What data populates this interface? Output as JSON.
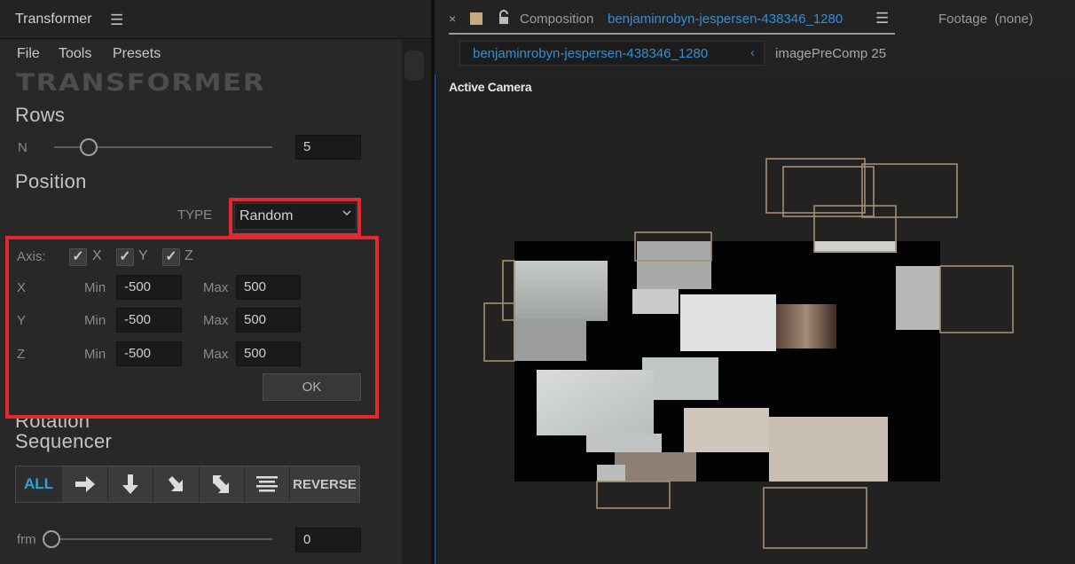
{
  "left_panel": {
    "title": "Transformer",
    "menu": [
      "File",
      "Tools",
      "Presets"
    ],
    "logo": "TRANSFORMER",
    "rows": {
      "title": "Rows",
      "n_label": "N",
      "n_value": "5",
      "slider_level": 0.16
    },
    "position": {
      "title": "Position",
      "type_label": "TYPE",
      "type_value": "Random",
      "axis_label": "Axis:",
      "axes": [
        "X",
        "Y",
        "Z"
      ],
      "axis_checks": [
        "✓",
        "✓",
        "✓"
      ],
      "ranges": [
        {
          "axis": "X",
          "min_label": "Min",
          "min": "-500",
          "max_label": "Max",
          "max": "500"
        },
        {
          "axis": "Y",
          "min_label": "Min",
          "min": "-500",
          "max_label": "Max",
          "max": "500"
        },
        {
          "axis": "Z",
          "min_label": "Min",
          "min": "-500",
          "max_label": "Max",
          "max": "500"
        }
      ],
      "ok_label": "OK"
    },
    "rotation_title": "Rotation",
    "sequencer": {
      "title": "Sequencer",
      "all_label": "ALL",
      "reverse_label": "REVERSE",
      "frm_label": "frm",
      "frm_value": "0",
      "frm_level": 0.0
    }
  },
  "right_panel": {
    "tab_close": "×",
    "composition_label": "Composition",
    "composition_name": "benjaminrobyn-jespersen-438346_1280",
    "footage_label": "Footage",
    "footage_value": "(none)",
    "breadcrumb_active": "benjaminrobyn-jespersen-438346_1280",
    "breadcrumb_next": "imagePreComp 25",
    "camera_label": "Active Camera"
  },
  "colors": {
    "accent_blue": "#2f90d8",
    "highlight_red": "#e3282f",
    "outline_tan": "#a48f70",
    "swatch": "#c4aa7e"
  }
}
